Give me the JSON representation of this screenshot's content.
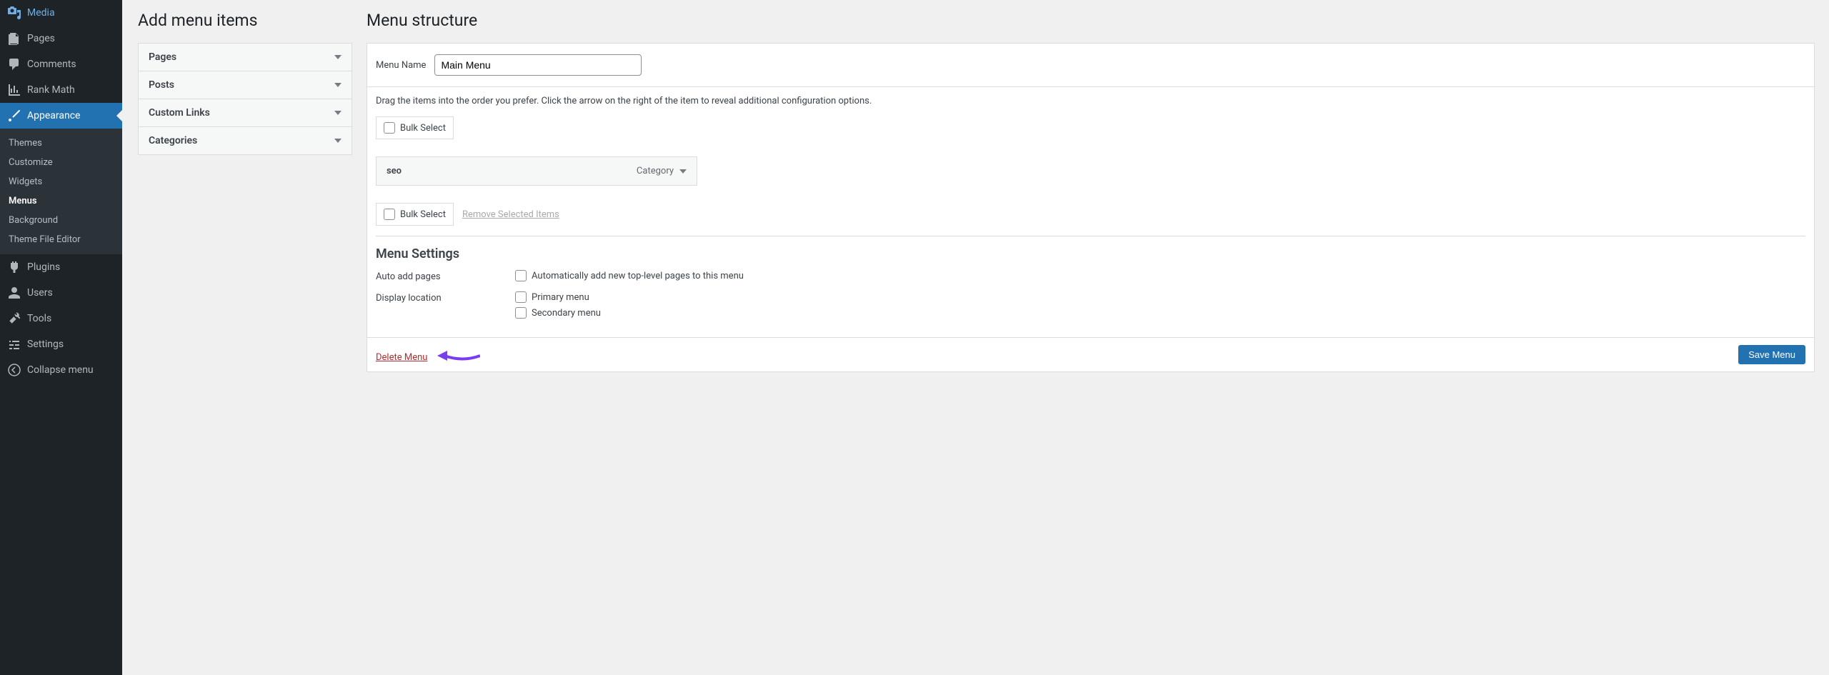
{
  "sidebar": {
    "media": "Media",
    "pages": "Pages",
    "comments": "Comments",
    "rankMath": "Rank Math",
    "appearance": "Appearance",
    "submenu": {
      "themes": "Themes",
      "customize": "Customize",
      "widgets": "Widgets",
      "menus": "Menus",
      "background": "Background",
      "themeFileEditor": "Theme File Editor"
    },
    "plugins": "Plugins",
    "users": "Users",
    "tools": "Tools",
    "settings": "Settings",
    "collapse": "Collapse menu"
  },
  "addItems": {
    "title": "Add menu items",
    "pages": "Pages",
    "posts": "Posts",
    "customLinks": "Custom Links",
    "categories": "Categories"
  },
  "structure": {
    "title": "Menu structure",
    "menuNameLabel": "Menu Name",
    "menuNameValue": "Main Menu",
    "instructions": "Drag the items into the order you prefer. Click the arrow on the right of the item to reveal additional configuration options.",
    "bulkSelect": "Bulk Select",
    "item": {
      "title": "seo",
      "type": "Category"
    },
    "removeSelected": "Remove Selected Items"
  },
  "settings": {
    "title": "Menu Settings",
    "autoAddLabel": "Auto add pages",
    "autoAddOption": "Automatically add new top-level pages to this menu",
    "displayLabel": "Display location",
    "primary": "Primary menu",
    "secondary": "Secondary menu"
  },
  "footer": {
    "delete": "Delete Menu",
    "save": "Save Menu"
  }
}
